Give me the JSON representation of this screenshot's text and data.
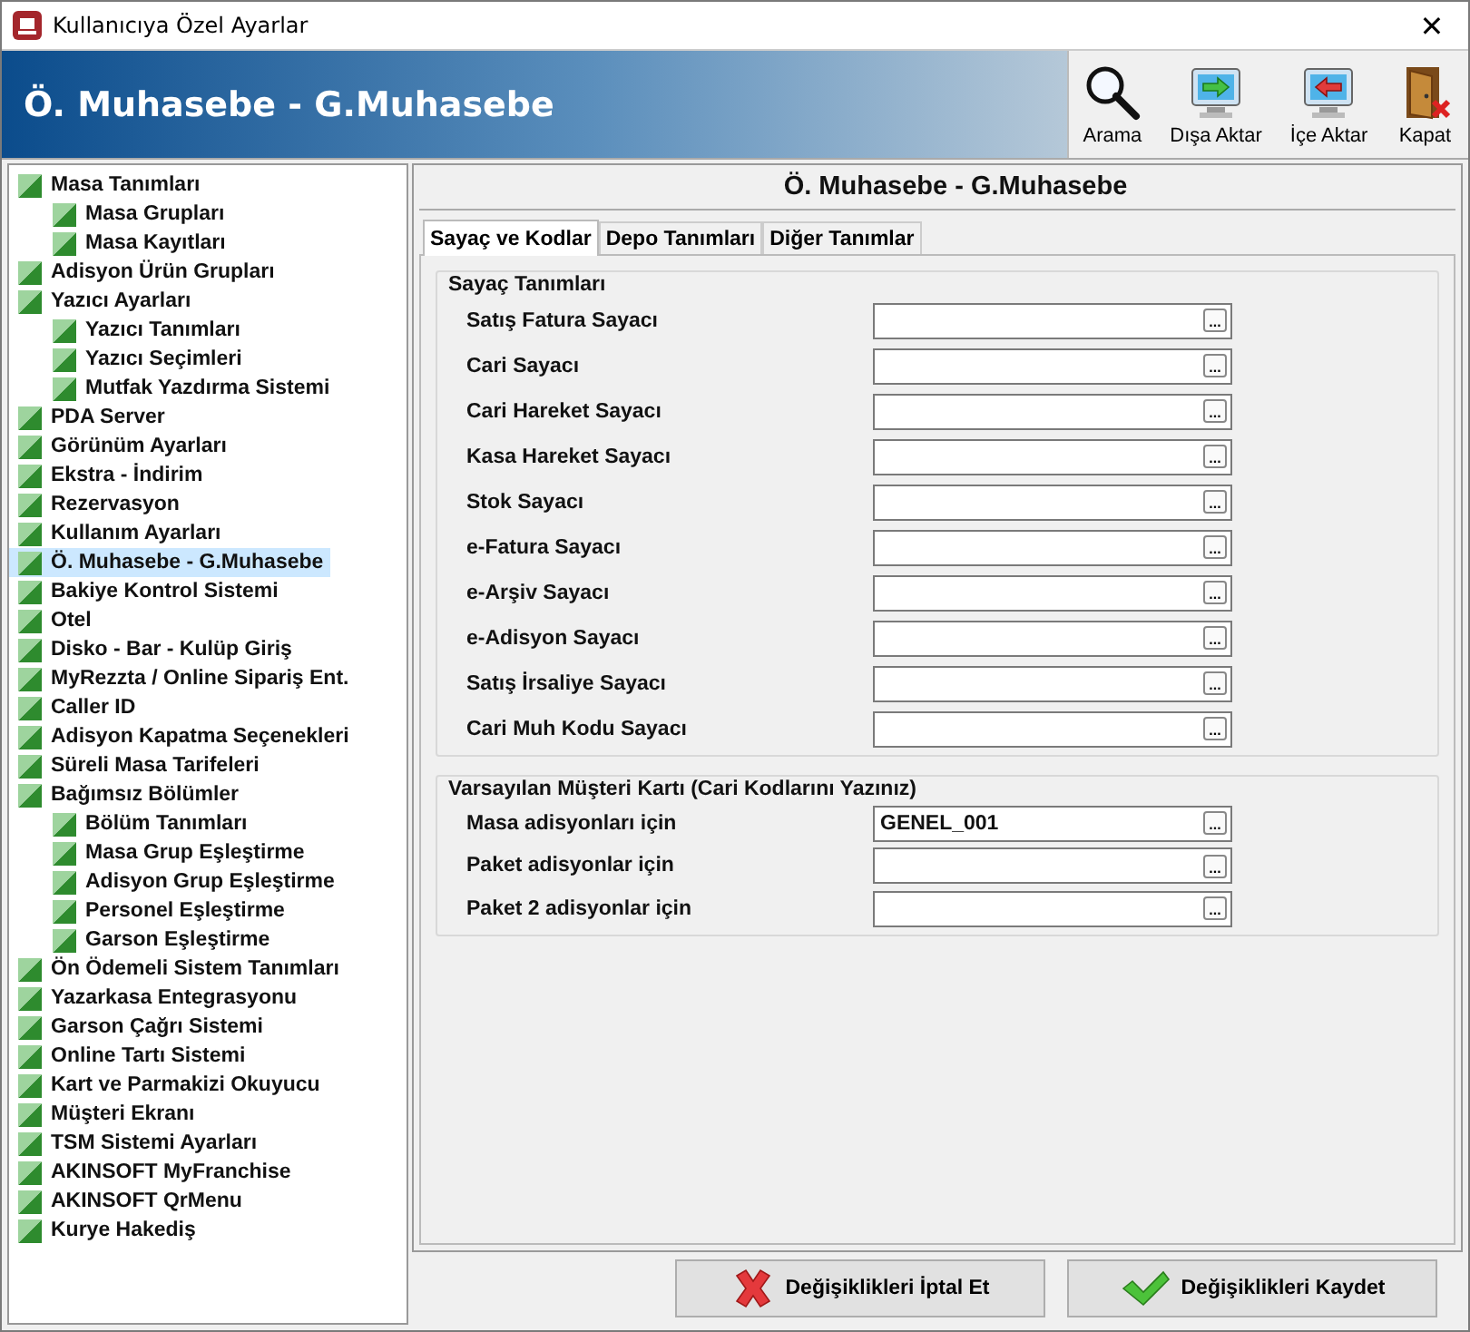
{
  "window": {
    "title": "Kullanıcıya Özel Ayarlar",
    "close": "✕"
  },
  "header": {
    "title": "Ö. Muhasebe - G.Muhasebe"
  },
  "toolbar": [
    {
      "kind": "search",
      "label": "Arama"
    },
    {
      "kind": "export",
      "label": "Dışa Aktar"
    },
    {
      "kind": "import",
      "label": "İçe Aktar"
    },
    {
      "kind": "exit",
      "label": "Kapat"
    }
  ],
  "sidebar": {
    "items": [
      {
        "label": "Masa Tanımları",
        "selected": false,
        "children": [
          {
            "label": "Masa Grupları",
            "selected": false
          },
          {
            "label": "Masa Kayıtları",
            "selected": false
          }
        ]
      },
      {
        "label": "Adisyon Ürün Grupları",
        "selected": false
      },
      {
        "label": "Yazıcı Ayarları",
        "selected": false,
        "children": [
          {
            "label": "Yazıcı Tanımları",
            "selected": false
          },
          {
            "label": "Yazıcı Seçimleri",
            "selected": false
          },
          {
            "label": "Mutfak Yazdırma Sistemi",
            "selected": false
          }
        ]
      },
      {
        "label": "PDA Server",
        "selected": false
      },
      {
        "label": "Görünüm Ayarları",
        "selected": false
      },
      {
        "label": "Ekstra - İndirim",
        "selected": false
      },
      {
        "label": "Rezervasyon",
        "selected": false
      },
      {
        "label": "Kullanım Ayarları",
        "selected": false
      },
      {
        "label": "Ö. Muhasebe - G.Muhasebe",
        "selected": true
      },
      {
        "label": "Bakiye Kontrol Sistemi",
        "selected": false
      },
      {
        "label": "Otel",
        "selected": false
      },
      {
        "label": "Disko - Bar - Kulüp Giriş",
        "selected": false
      },
      {
        "label": "MyRezzta / Online Sipariş Ent.",
        "selected": false
      },
      {
        "label": "Caller ID",
        "selected": false
      },
      {
        "label": "Adisyon Kapatma Seçenekleri",
        "selected": false
      },
      {
        "label": "Süreli Masa Tarifeleri",
        "selected": false
      },
      {
        "label": "Bağımsız Bölümler",
        "selected": false,
        "children": [
          {
            "label": "Bölüm Tanımları",
            "selected": false
          },
          {
            "label": "Masa Grup Eşleştirme",
            "selected": false
          },
          {
            "label": "Adisyon Grup Eşleştirme",
            "selected": false
          },
          {
            "label": "Personel Eşleştirme",
            "selected": false
          },
          {
            "label": "Garson Eşleştirme",
            "selected": false
          }
        ]
      },
      {
        "label": "Ön Ödemeli Sistem Tanımları",
        "selected": false
      },
      {
        "label": "Yazarkasa Entegrasyonu",
        "selected": false
      },
      {
        "label": "Garson Çağrı Sistemi",
        "selected": false
      },
      {
        "label": "Online Tartı Sistemi",
        "selected": false
      },
      {
        "label": "Kart ve Parmakizi Okuyucu",
        "selected": false
      },
      {
        "label": "Müşteri Ekranı",
        "selected": false
      },
      {
        "label": "TSM Sistemi Ayarları",
        "selected": false
      },
      {
        "label": "AKINSOFT MyFranchise",
        "selected": false
      },
      {
        "label": "AKINSOFT QrMenu",
        "selected": false
      },
      {
        "label": "Kurye Hakediş",
        "selected": false
      }
    ]
  },
  "panel": {
    "title": "Ö. Muhasebe - G.Muhasebe",
    "tabs": [
      {
        "label": "Sayaç ve Kodlar",
        "selected": true
      },
      {
        "label": "Depo Tanımları",
        "selected": false
      },
      {
        "label": "Diğer Tanımlar",
        "selected": false
      }
    ],
    "groups": [
      {
        "title": "Sayaç Tanımları",
        "fields": [
          {
            "label": "Satış Fatura Sayacı"
          },
          {
            "label": "Cari Sayacı"
          },
          {
            "label": "Cari Hareket Sayacı"
          },
          {
            "label": "Kasa Hareket Sayacı"
          },
          {
            "label": "Stok Sayacı"
          },
          {
            "label": "e-Fatura Sayacı"
          },
          {
            "label": "e-Arşiv Sayacı"
          },
          {
            "label": "e-Adisyon Sayacı"
          },
          {
            "label": "Satış İrsaliye Sayacı"
          },
          {
            "label": "Cari Muh Kodu Sayacı"
          }
        ]
      },
      {
        "title": "Varsayılan Müşteri Kartı (Cari Kodlarını Yazınız)",
        "fields": [
          {
            "label": "Masa adisyonları için",
            "value": "GENEL_001"
          },
          {
            "label": "Paket adisyonlar için"
          },
          {
            "label": "Paket 2 adisyonlar için"
          }
        ]
      }
    ],
    "browse_label": "..."
  },
  "buttons": [
    {
      "kind": "cancel",
      "label": "Değişiklikleri İptal Et"
    },
    {
      "kind": "save",
      "label": "Değişiklikleri Kaydet"
    }
  ]
}
